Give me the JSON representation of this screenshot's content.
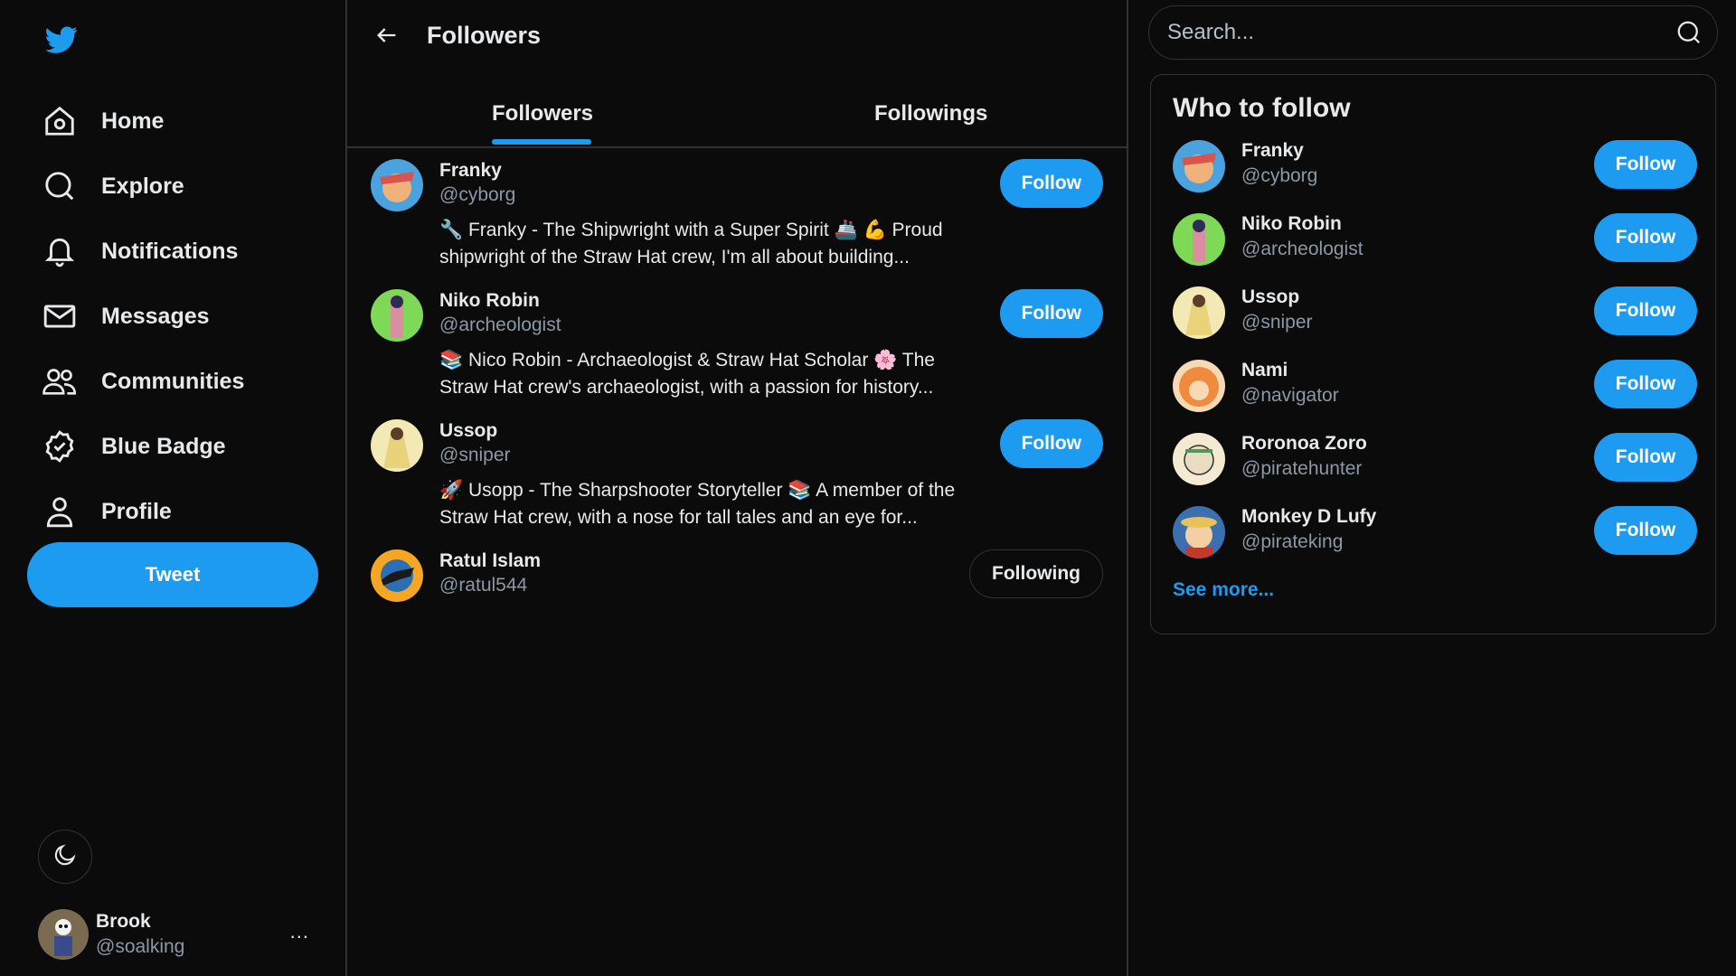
{
  "sidebar": {
    "nav": [
      {
        "label": "Home",
        "icon": "home-icon"
      },
      {
        "label": "Explore",
        "icon": "search-icon"
      },
      {
        "label": "Notifications",
        "icon": "bell-icon"
      },
      {
        "label": "Messages",
        "icon": "mail-icon"
      },
      {
        "label": "Communities",
        "icon": "people-icon"
      },
      {
        "label": "Blue Badge",
        "icon": "badge-check-icon"
      },
      {
        "label": "Profile",
        "icon": "user-icon"
      }
    ],
    "tweet_label": "Tweet",
    "current_user": {
      "name": "Brook",
      "handle": "@soalking"
    },
    "more_label": "..."
  },
  "main": {
    "title": "Followers",
    "tabs": [
      {
        "label": "Followers",
        "active": true
      },
      {
        "label": "Followings",
        "active": false
      }
    ],
    "users": [
      {
        "name": "Franky",
        "handle": "@cyborg",
        "bio": "🔧 Franky - The Shipwright with a Super Spirit 🚢 💪 Proud shipwright of the Straw Hat crew, I'm all about building...",
        "action": "Follow",
        "avatar_color": "#d9534f"
      },
      {
        "name": "Niko Robin",
        "handle": "@archeologist",
        "bio": "📚 Nico Robin - Archaeologist & Straw Hat Scholar 🌸 The Straw Hat crew's archaeologist, with a passion for history...",
        "action": "Follow",
        "avatar_color": "#7ed957"
      },
      {
        "name": "Ussop",
        "handle": "@sniper",
        "bio": "🚀 Usopp - The Sharpshooter Storyteller 📚 A member of the Straw Hat crew, with a nose for tall tales and an eye for...",
        "action": "Follow",
        "avatar_color": "#e8d27a"
      },
      {
        "name": "Ratul Islam",
        "handle": "@ratul544",
        "bio": "",
        "action": "Following",
        "avatar_color": "#f5a623"
      }
    ]
  },
  "right": {
    "search_placeholder": "Search...",
    "who_to_follow_title": "Who to follow",
    "suggestions": [
      {
        "name": "Franky",
        "handle": "@cyborg",
        "action": "Follow",
        "avatar_color": "#d9534f"
      },
      {
        "name": "Niko Robin",
        "handle": "@archeologist",
        "action": "Follow",
        "avatar_color": "#7ed957"
      },
      {
        "name": "Ussop",
        "handle": "@sniper",
        "action": "Follow",
        "avatar_color": "#e8d27a"
      },
      {
        "name": "Nami",
        "handle": "@navigator",
        "action": "Follow",
        "avatar_color": "#f08a3c"
      },
      {
        "name": "Roronoa Zoro",
        "handle": "@piratehunter",
        "action": "Follow",
        "avatar_color": "#e9dcc0"
      },
      {
        "name": "Monkey D Lufy",
        "handle": "@pirateking",
        "action": "Follow",
        "avatar_color": "#c0392b"
      }
    ],
    "see_more_label": "See more..."
  },
  "colors": {
    "accent": "#1d9bf0",
    "background": "#0b0b0c",
    "border": "#2f3336",
    "muted_text": "#8b98a5"
  }
}
